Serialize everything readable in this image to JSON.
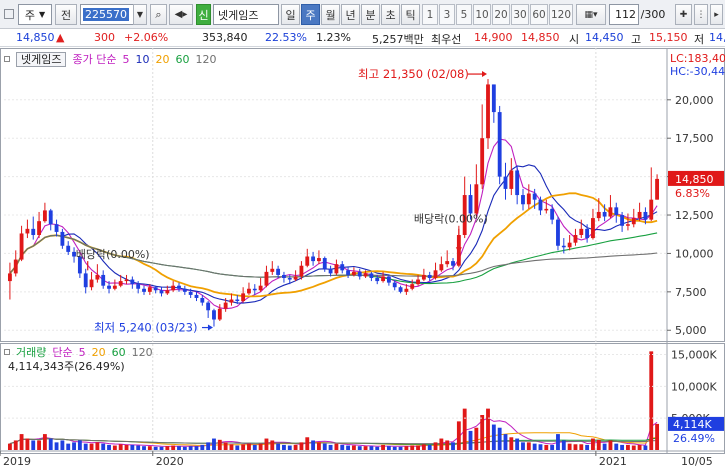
{
  "toolbar": {
    "market": "주",
    "market_btn": "전",
    "code": "225570",
    "name": "넷게임즈",
    "new_badge": "신",
    "periods": [
      "일",
      "주",
      "월",
      "년",
      "분",
      "초",
      "틱"
    ],
    "active_period": "주",
    "nums": [
      "1",
      "3",
      "5",
      "10",
      "20",
      "30",
      "60",
      "120"
    ],
    "count": "112",
    "total": "/300"
  },
  "quote": {
    "price": "14,850",
    "change": "300",
    "change_pct": "+2.06%",
    "volume": "353,840",
    "turnover_rate": "22.53%",
    "ratio": "1.23%",
    "amount": "5,257백만",
    "label_best_sell": "최우선",
    "best_sell": "14,900",
    "best_buy": "14,850",
    "label_open": "시",
    "open": "14,450",
    "label_high": "고",
    "high": "15,150",
    "label_low": "저",
    "low": "14,"
  },
  "price_panel": {
    "legend_name": "넷게임즈",
    "legend_type": "종가 단순",
    "ma_periods": [
      "5",
      "10",
      "20",
      "60",
      "120"
    ],
    "ma_colors": [
      "#c020c0",
      "#1a2ab8",
      "#f0a000",
      "#18a040",
      "#707070"
    ],
    "lc": "LC:183,40",
    "hc": "HC:-30,44",
    "current_price": "14,850",
    "current_pct": "6.83%",
    "annot_high": "최고 21,350 (02/08)",
    "annot_low": "최저 5,240 (03/23)",
    "annot_div1": "배당락(0.00%)",
    "annot_div2": "배당락(0.00%)",
    "yticks": [
      "20,000",
      "17,500",
      "15,000",
      "12,500",
      "10,000",
      "7,500",
      "5,000"
    ]
  },
  "volume_panel": {
    "legend_name": "거래량",
    "legend_type": "단순",
    "ma_periods": [
      "5",
      "20",
      "60",
      "120"
    ],
    "ma_colors": [
      "#c020c0",
      "#f0a000",
      "#18a040",
      "#707070"
    ],
    "value_text": "4,114,343주(26.49%)",
    "current": "4,114K",
    "current_pct": "26.49%",
    "yticks": [
      "15,000K",
      "10,000K",
      "5,000K"
    ]
  },
  "xaxis": {
    "labels": [
      "2019",
      "2020",
      "2021"
    ],
    "right_label": "10/05"
  },
  "chart_data": {
    "type": "candlestick",
    "interval": "weekly",
    "title": "넷게임즈",
    "y_range": [
      4300,
      22200
    ],
    "vol_range": [
      0,
      16500000
    ],
    "yticks": [
      5000,
      7500,
      10000,
      12500,
      15000,
      17500,
      20000
    ],
    "candles": [
      [
        8200,
        8700,
        9400,
        7000,
        1.0
      ],
      [
        8700,
        9600,
        10200,
        8500,
        1.5
      ],
      [
        9600,
        11300,
        11800,
        9500,
        2.5
      ],
      [
        11300,
        11600,
        12200,
        11000,
        1.8
      ],
      [
        11600,
        11200,
        12400,
        10900,
        1.5
      ],
      [
        11200,
        12100,
        12700,
        11000,
        1.5
      ],
      [
        12100,
        12800,
        13300,
        12000,
        2.5
      ],
      [
        12800,
        11900,
        12900,
        11500,
        1.8
      ],
      [
        11900,
        11400,
        12200,
        11100,
        1.2
      ],
      [
        11400,
        10500,
        11600,
        10300,
        1.5
      ],
      [
        10500,
        10100,
        10800,
        9900,
        1.0
      ],
      [
        10100,
        9800,
        10400,
        9400,
        1.2
      ],
      [
        9800,
        8700,
        9900,
        8400,
        1.5
      ],
      [
        8700,
        7800,
        9000,
        7400,
        1.0
      ],
      [
        7800,
        8300,
        8800,
        7600,
        1.0
      ],
      [
        8300,
        8600,
        9300,
        8100,
        1.2
      ],
      [
        8600,
        7900,
        8900,
        7700,
        1.0
      ],
      [
        7900,
        7700,
        8200,
        7400,
        0.8
      ],
      [
        7700,
        7900,
        8300,
        7600,
        0.7
      ],
      [
        7900,
        8200,
        8600,
        7800,
        0.9
      ],
      [
        8200,
        8300,
        8600,
        8000,
        0.8
      ],
      [
        8300,
        8000,
        8500,
        7700,
        0.8
      ],
      [
        8000,
        7700,
        8200,
        7400,
        0.7
      ],
      [
        7700,
        7500,
        7900,
        7300,
        0.6
      ],
      [
        7500,
        7800,
        8000,
        7300,
        0.6
      ],
      [
        7800,
        7600,
        7900,
        7400,
        0.5
      ],
      [
        7600,
        7400,
        7800,
        7200,
        0.5
      ],
      [
        7400,
        7600,
        7900,
        7300,
        0.6
      ],
      [
        7600,
        7900,
        8200,
        7500,
        0.7
      ],
      [
        7900,
        7700,
        8100,
        7500,
        0.6
      ],
      [
        7700,
        7500,
        7900,
        7300,
        0.5
      ],
      [
        7500,
        7300,
        7700,
        7100,
        0.6
      ],
      [
        7300,
        7100,
        7500,
        6900,
        0.6
      ],
      [
        7100,
        6800,
        7300,
        6600,
        0.8
      ],
      [
        6800,
        6300,
        6900,
        5800,
        1.2
      ],
      [
        6300,
        5700,
        6400,
        5240,
        1.8
      ],
      [
        5700,
        6400,
        6700,
        5600,
        1.6
      ],
      [
        6400,
        6800,
        7100,
        6200,
        1.2
      ],
      [
        6800,
        7000,
        7400,
        6600,
        0.9
      ],
      [
        7000,
        6900,
        7300,
        6700,
        0.7
      ],
      [
        6900,
        7400,
        7800,
        6800,
        0.9
      ],
      [
        7400,
        7700,
        8100,
        7300,
        1.0
      ],
      [
        7700,
        7600,
        8000,
        7300,
        0.8
      ],
      [
        7600,
        7900,
        8400,
        7500,
        1.0
      ],
      [
        7900,
        8800,
        9200,
        7800,
        1.8
      ],
      [
        8800,
        9000,
        9500,
        8600,
        1.5
      ],
      [
        9000,
        8600,
        9200,
        8400,
        1.0
      ],
      [
        8600,
        8400,
        8800,
        8100,
        0.8
      ],
      [
        8400,
        8300,
        8600,
        8000,
        0.7
      ],
      [
        8300,
        8500,
        8900,
        8200,
        0.8
      ],
      [
        8500,
        9200,
        9500,
        8300,
        1.2
      ],
      [
        9200,
        9800,
        10300,
        9100,
        2.0
      ],
      [
        9800,
        9500,
        10100,
        9200,
        1.5
      ],
      [
        9500,
        9700,
        10200,
        9300,
        1.2
      ],
      [
        9700,
        9000,
        9800,
        8800,
        1.0
      ],
      [
        9000,
        8700,
        9200,
        8500,
        0.8
      ],
      [
        8700,
        9300,
        9600,
        8600,
        1.0
      ],
      [
        9300,
        8900,
        9500,
        8700,
        0.8
      ],
      [
        8900,
        8600,
        9100,
        8400,
        0.7
      ],
      [
        8600,
        8800,
        9100,
        8500,
        0.7
      ],
      [
        8800,
        8500,
        9000,
        8300,
        0.6
      ],
      [
        8500,
        8700,
        8900,
        8400,
        0.6
      ],
      [
        8700,
        8400,
        8800,
        8200,
        0.6
      ],
      [
        8400,
        8200,
        8600,
        8000,
        0.5
      ],
      [
        8200,
        8500,
        8800,
        8100,
        0.8
      ],
      [
        8500,
        8100,
        8600,
        7900,
        0.6
      ],
      [
        8100,
        7800,
        8300,
        7600,
        0.5
      ],
      [
        7800,
        7500,
        7900,
        7400,
        0.5
      ],
      [
        7500,
        7700,
        8000,
        7300,
        0.6
      ],
      [
        7700,
        8000,
        8300,
        7600,
        0.7
      ],
      [
        8000,
        8300,
        8600,
        7900,
        0.7
      ],
      [
        8300,
        8600,
        9000,
        8200,
        0.9
      ],
      [
        8600,
        8400,
        8800,
        8200,
        0.8
      ],
      [
        8400,
        8900,
        9400,
        8300,
        1.2
      ],
      [
        8900,
        9300,
        9800,
        8800,
        1.8
      ],
      [
        9300,
        9500,
        10200,
        9100,
        1.5
      ],
      [
        9500,
        9200,
        9700,
        8900,
        1.2
      ],
      [
        9200,
        11200,
        11800,
        9100,
        4.5
      ],
      [
        11200,
        13800,
        15000,
        11000,
        6.5
      ],
      [
        13800,
        12600,
        14500,
        12200,
        3.0
      ],
      [
        12600,
        14500,
        15800,
        12400,
        3.5
      ],
      [
        14500,
        17500,
        19700,
        14200,
        5.5
      ],
      [
        17500,
        21000,
        21350,
        16800,
        6.5
      ],
      [
        21000,
        19200,
        21000,
        18500,
        4.0
      ],
      [
        19200,
        15000,
        19600,
        14500,
        3.5
      ],
      [
        15000,
        14200,
        15900,
        13500,
        2.5
      ],
      [
        14200,
        15400,
        16200,
        13800,
        2.0
      ],
      [
        15400,
        13800,
        15700,
        13200,
        1.8
      ],
      [
        13800,
        13200,
        14200,
        12800,
        1.2
      ],
      [
        13200,
        13900,
        14500,
        12900,
        1.2
      ],
      [
        13900,
        13500,
        14200,
        12900,
        1.0
      ],
      [
        13500,
        12800,
        13700,
        12500,
        0.9
      ],
      [
        12800,
        12900,
        13500,
        12600,
        0.8
      ],
      [
        12900,
        12200,
        13200,
        11900,
        0.8
      ],
      [
        12200,
        10500,
        12400,
        10200,
        2.5
      ],
      [
        10500,
        10400,
        11000,
        10000,
        1.5
      ],
      [
        10400,
        10700,
        11200,
        10200,
        1.0
      ],
      [
        10700,
        11200,
        11600,
        10500,
        0.9
      ],
      [
        11200,
        11600,
        12200,
        11000,
        0.9
      ],
      [
        11600,
        11000,
        11900,
        10700,
        0.8
      ],
      [
        11000,
        12300,
        12900,
        10900,
        1.8
      ],
      [
        12300,
        12700,
        13600,
        12100,
        1.6
      ],
      [
        12700,
        12400,
        13200,
        12100,
        1.0
      ],
      [
        12400,
        13000,
        13800,
        12300,
        1.5
      ],
      [
        13000,
        12500,
        13300,
        12000,
        1.0
      ],
      [
        12500,
        11800,
        12700,
        11400,
        0.8
      ],
      [
        11800,
        11900,
        12600,
        11500,
        0.8
      ],
      [
        11900,
        12300,
        12900,
        11700,
        0.7
      ],
      [
        12300,
        12700,
        13300,
        12100,
        0.8
      ],
      [
        12700,
        12200,
        13000,
        11900,
        0.7
      ],
      [
        12200,
        13500,
        15600,
        12100,
        15.5
      ],
      [
        13500,
        14850,
        15150,
        13500,
        4.1
      ]
    ],
    "volume_unit": "millions of shares",
    "ma_series": [
      "5",
      "10",
      "20",
      "60",
      "120"
    ],
    "annotations": [
      {
        "label": "최고 21,350 (02/08)",
        "price": 21350
      },
      {
        "label": "최저 5,240 (03/23)",
        "price": 5240
      },
      {
        "label": "배당락(0.00%)",
        "week": 13
      },
      {
        "label": "배당락(0.00%)",
        "week": 77
      }
    ]
  }
}
